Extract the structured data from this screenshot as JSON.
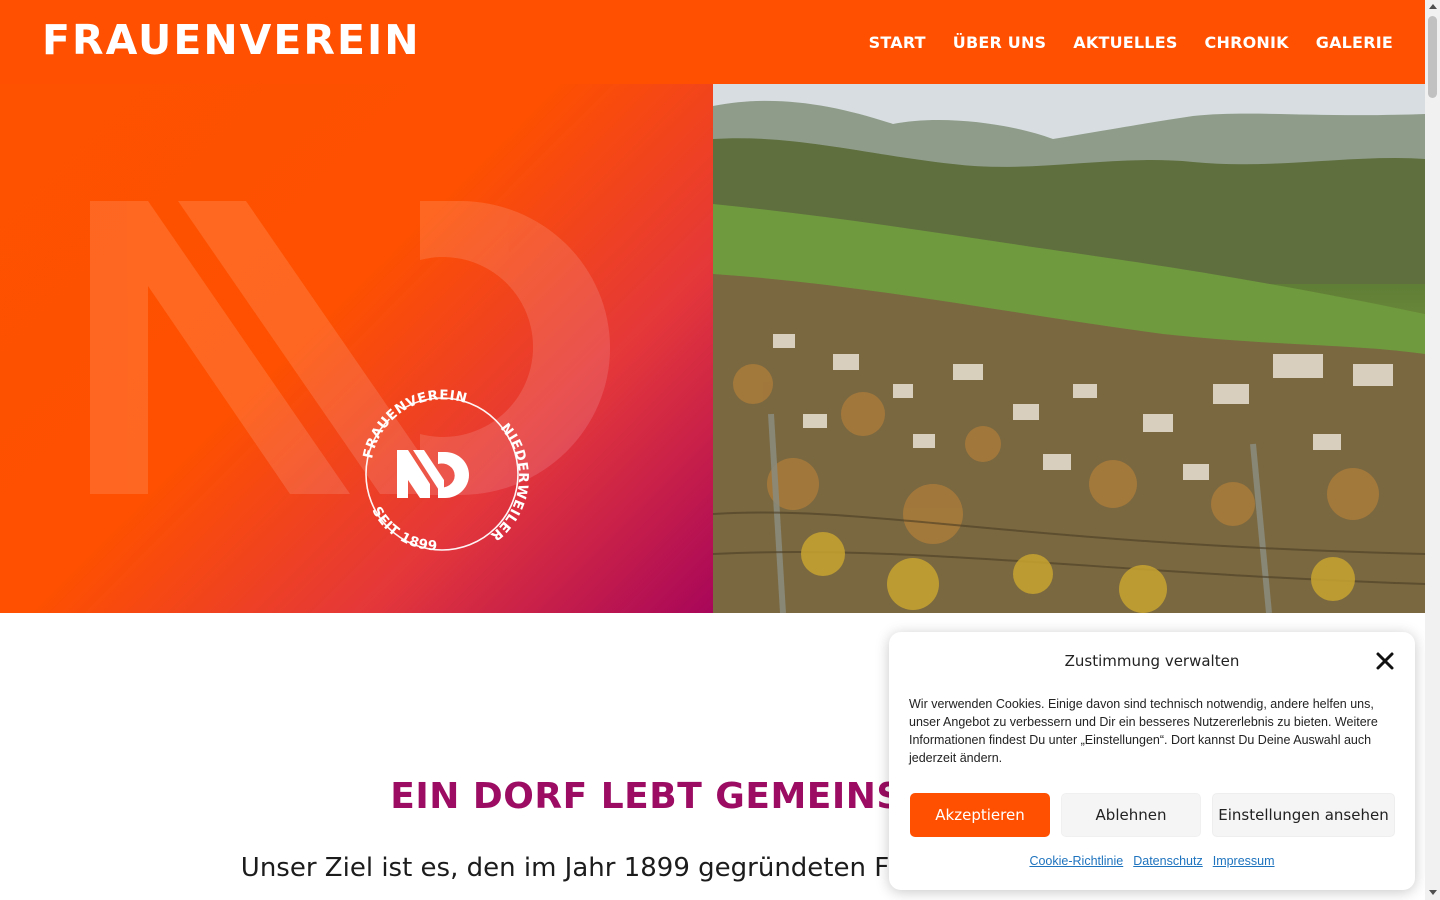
{
  "header": {
    "logo_text": "FRAUENVEREIN",
    "nav": [
      {
        "label": "START"
      },
      {
        "label": "ÜBER UNS"
      },
      {
        "label": "AKTUELLES"
      },
      {
        "label": "CHRONIK"
      },
      {
        "label": "GALERIE"
      }
    ],
    "background_color": "#fe5000"
  },
  "hero": {
    "seal_top_text": "FRAUENVEREIN",
    "seal_right_text": "NIEDERWEILER",
    "seal_bottom_text": "SEIT 1899",
    "photo_icon": "village-landscape-image"
  },
  "main": {
    "headline": "EIN DORF LEBT GEMEINSC",
    "intro": "Unser Ziel ist es, den im Jahr 1899 gegründeten F"
  },
  "cookie_banner": {
    "title": "Zustimmung verwalten",
    "text": "Wir verwenden Cookies. Einige davon sind technisch notwendig, andere helfen uns, unser Angebot zu verbessern und Dir ein besseres Nutzererlebnis zu bieten. Weitere Informationen findest Du unter „Einstellungen“. Dort kannst Du Deine Auswahl auch jederzeit ändern.",
    "accept_label": "Akzeptieren",
    "deny_label": "Ablehnen",
    "settings_label": "Einstellungen ansehen",
    "links": [
      {
        "label": "Cookie-Richtlinie"
      },
      {
        "label": "Datenschutz"
      },
      {
        "label": "Impressum"
      }
    ],
    "accent_color": "#fe5000"
  },
  "colors": {
    "brand_orange": "#fe5000",
    "headline_purple": "#9b0c62"
  }
}
